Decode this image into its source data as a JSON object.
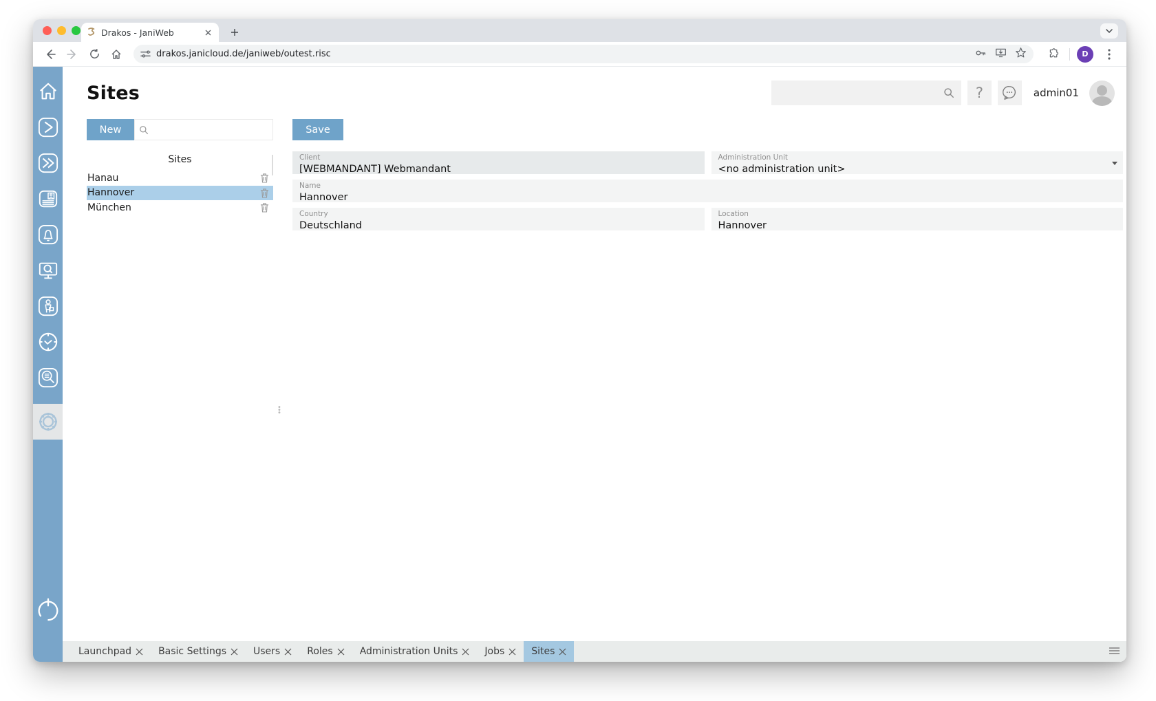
{
  "browser": {
    "tab_title": "Drakos - JaniWeb",
    "url": "drakos.janicloud.de/janiweb/outest.risc",
    "profile_initial": "D"
  },
  "header": {
    "title": "Sites",
    "help_glyph": "?",
    "username": "admin01"
  },
  "list_panel": {
    "new_button": "New",
    "column_header": "Sites",
    "items": [
      {
        "label": "Hanau"
      },
      {
        "label": "Hannover"
      },
      {
        "label": "München"
      }
    ],
    "selected_item": "Hannover"
  },
  "form": {
    "save_button": "Save",
    "client": {
      "label": "Client",
      "value": "[WEBMANDANT] Webmandant"
    },
    "admin_unit": {
      "label": "Administration Unit",
      "value": "<no administration unit>"
    },
    "name": {
      "label": "Name",
      "value": "Hannover"
    },
    "country": {
      "label": "Country",
      "value": "Deutschland"
    },
    "location": {
      "label": "Location",
      "value": "Hannover"
    }
  },
  "bottom_tabs": [
    {
      "label": "Launchpad"
    },
    {
      "label": "Basic Settings"
    },
    {
      "label": "Users"
    },
    {
      "label": "Roles"
    },
    {
      "label": "Administration Units"
    },
    {
      "label": "Jobs"
    },
    {
      "label": "Sites"
    }
  ],
  "active_bottom_tab": "Sites",
  "colors": {
    "sidebar": "#79a5c9",
    "accent_button": "#6fa3c9",
    "selected_row": "#abcfe9",
    "active_tab": "#a4c8e1"
  }
}
